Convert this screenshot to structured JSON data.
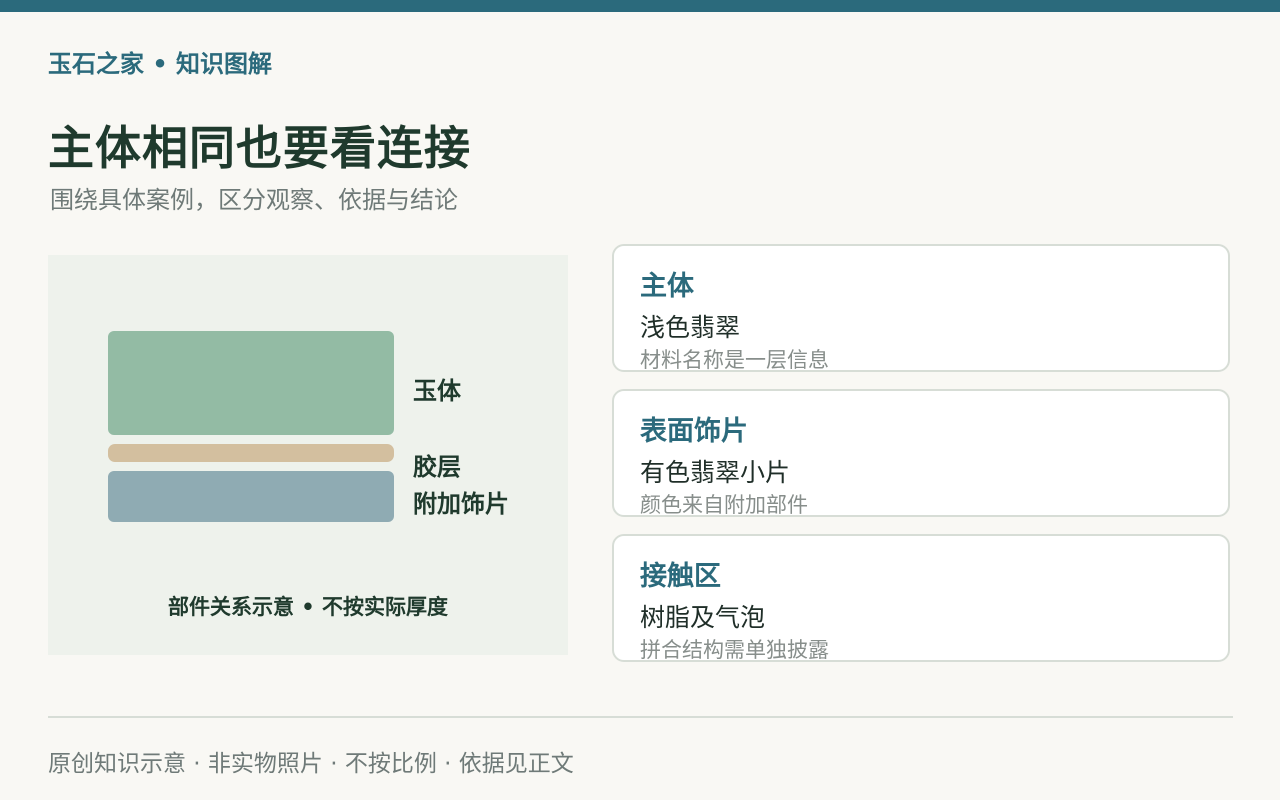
{
  "brand": "玉石之家 • 知识图解",
  "title": "主体相同也要看连接",
  "subtitle": "围绕具体案例，区分观察、依据与结论",
  "diagram": {
    "layers": [
      {
        "label": "玉体",
        "color": "#93bba4"
      },
      {
        "label": "胶层",
        "color": "#d3bf9f"
      },
      {
        "label": "附加饰片",
        "color": "#8fabb3"
      }
    ],
    "caption": "部件关系示意 • 不按实际厚度"
  },
  "cards": [
    {
      "title": "主体",
      "value": "浅色翡翠",
      "note": "材料名称是一层信息"
    },
    {
      "title": "表面饰片",
      "value": "有色翡翠小片",
      "note": "颜色来自附加部件"
    },
    {
      "title": "接触区",
      "value": "树脂及气泡",
      "note": "拼合结构需单独披露"
    }
  ],
  "footer": "原创知识示意 · 非实物照片 · 不按比例 · 依据见正文",
  "colors": {
    "accent": "#2b6a7c",
    "title": "#1f3a2d",
    "background": "#f9f8f4",
    "panel": "#eef2ec"
  }
}
